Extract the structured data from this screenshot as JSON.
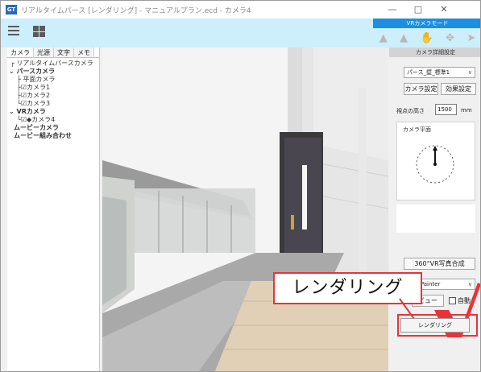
{
  "window": {
    "title": "リアルタイムパース [レンダリング] - マニュアルプラン.ecd - カメラ4",
    "app_icon_label": "GT",
    "minimize": "—",
    "maximize": "□",
    "close": "✕"
  },
  "toolbar": {
    "vr_mode_label": "VRカメラモード"
  },
  "left_panel": {
    "tabs": [
      "カメラ",
      "光源",
      "文字",
      "メモ"
    ],
    "tree": [
      "リアルタイムパースカメラ",
      "パースカメラ",
      "平面カメラ",
      "カメラ1",
      "カメラ2",
      "カメラ3",
      "VRカメラ",
      "◆カメラ4",
      "ムービーカメラ",
      "ムービー組み合わせ"
    ]
  },
  "right_panel": {
    "header": "カメラ詳細設定",
    "preset_select": "パース_壁_標準1",
    "camera_settings_button": "カメラ設定",
    "effect_settings_button": "効果設定",
    "eye_height_label": "視点の高さ",
    "eye_height_value": "1500",
    "eye_height_unit": "mm",
    "camera_plane_label": "カメラ平面",
    "vr_compose_button": "360°VR写真合成",
    "renderer_select": "e-Painter",
    "preview_button": "ビュー",
    "auto_checkbox_label": "自動",
    "render_button": "レンダリング"
  },
  "callout": {
    "text": "レンダリング",
    "accent_color": "#e8333a"
  },
  "colors": {
    "toolbar_bg": "#cdeefb",
    "vr_header_bg": "#1a8fe4"
  }
}
